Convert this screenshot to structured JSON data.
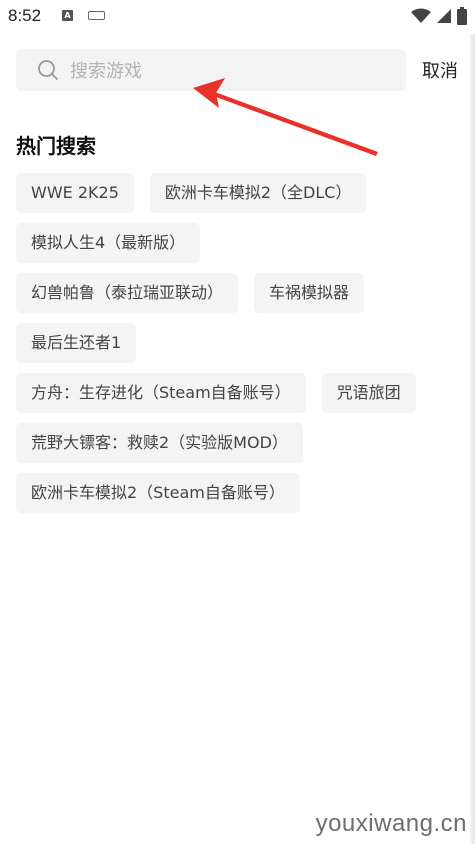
{
  "status_bar": {
    "time": "8:52",
    "notification_icon_letter": "A",
    "icons": [
      "a-notification-icon",
      "keyboard-icon",
      "wifi-icon",
      "signal-icon",
      "battery-icon"
    ]
  },
  "search": {
    "placeholder": "搜索游戏",
    "value": "",
    "cancel_label": "取消"
  },
  "hot_search": {
    "title": "热门搜索",
    "rows": [
      [
        "WWE 2K25",
        "欧洲卡车模拟2（全DLC）"
      ],
      [
        "模拟人生4（最新版）"
      ],
      [
        "幻兽帕鲁（泰拉瑞亚联动）",
        "车祸模拟器"
      ],
      [
        "最后生还者1"
      ],
      [
        "方舟：生存进化（Steam自备账号）",
        "咒语旅团"
      ],
      [
        "荒野大镖客：救赎2（实验版MOD）"
      ],
      [
        "欧洲卡车模拟2（Steam自备账号）"
      ]
    ]
  },
  "annotation": {
    "arrow_color": "#e8312a"
  },
  "watermark": "youxiwang.cn"
}
